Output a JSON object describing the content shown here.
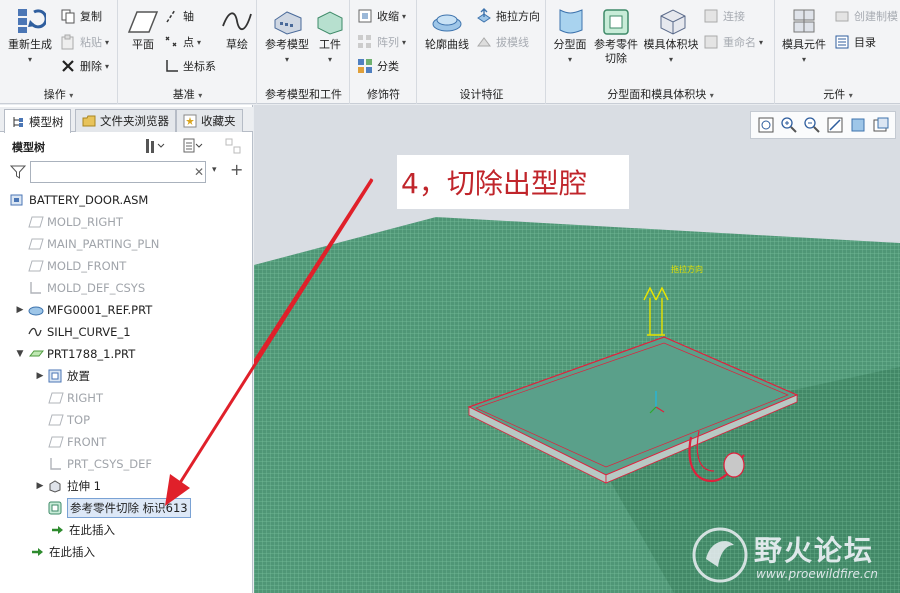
{
  "ribbon": {
    "operations": {
      "regenerate": "重新生成",
      "copy": "复制",
      "paste": "粘贴",
      "delete": "删除",
      "group": "操作"
    },
    "datum": {
      "plane": "平面",
      "axis": "轴",
      "point": "点",
      "csys": "坐标系",
      "sketch": "草绘",
      "group": "基准"
    },
    "ref_model": {
      "ref_model": "参考模型",
      "workpiece": "工件",
      "group": "参考模型和工件"
    },
    "modifiers": {
      "shrink": "收缩",
      "pattern": "阵列",
      "classify": "分类",
      "group": "修饰符"
    },
    "design": {
      "silhouette": "轮廓曲线",
      "pull_direction": "拖拉方向",
      "draft_line": "拔模线",
      "group": "设计特征"
    },
    "parting": {
      "parting_surface": "分型面",
      "ref_part_cutout_l1": "参考零件",
      "ref_part_cutout_l2": "切除",
      "mold_volume": "模具体积块",
      "connect": "连接",
      "rename": "重命名",
      "group": "分型面和模具体积块"
    },
    "components": {
      "mold_component": "模具元件",
      "create_blank": "创建制模",
      "catalog": "目录",
      "group": "元件"
    }
  },
  "leftpanel": {
    "tabs": [
      "模型树",
      "文件夹浏览器",
      "收藏夹"
    ],
    "tree_title": "模型树",
    "filter_placeholder": "",
    "filter_value": "",
    "nodes": [
      {
        "label": "BATTERY_DOOR.ASM",
        "icon": "assembly-icon"
      },
      {
        "label": "MOLD_RIGHT",
        "icon": "datum-plane-icon"
      },
      {
        "label": "MAIN_PARTING_PLN",
        "icon": "datum-plane-icon"
      },
      {
        "label": "MOLD_FRONT",
        "icon": "datum-plane-icon"
      },
      {
        "label": "MOLD_DEF_CSYS",
        "icon": "csys-icon"
      },
      {
        "label": "MFG0001_REF.PRT",
        "icon": "part-icon"
      },
      {
        "label": "SILH_CURVE_1",
        "icon": "curve-icon"
      },
      {
        "label": "PRT1788_1.PRT",
        "icon": "part-icon"
      },
      {
        "label": "放置",
        "icon": "placement-icon"
      },
      {
        "label": "RIGHT",
        "icon": "datum-plane-icon"
      },
      {
        "label": "TOP",
        "icon": "datum-plane-icon"
      },
      {
        "label": "FRONT",
        "icon": "datum-plane-icon"
      },
      {
        "label": "PRT_CSYS_DEF",
        "icon": "csys-icon"
      },
      {
        "label": "拉伸 1",
        "icon": "extrude-icon"
      },
      {
        "label": "参考零件切除 标识613",
        "icon": "cutout-icon"
      },
      {
        "label": "在此插入",
        "icon": "insert-here-icon"
      },
      {
        "label": "在此插入",
        "icon": "insert-here-icon"
      }
    ]
  },
  "viewport": {
    "callout": "4，切除出型腔",
    "pull_label": "拖拉方向",
    "watermark_cn": "野火论坛",
    "watermark_url": "www.proewildfire.cn"
  },
  "colors": {
    "mesh_green": "#5a9e80",
    "edge_red": "#e0203c",
    "annotation_red": "#c0252b",
    "arrow_yellow": "#e8e400",
    "selection_blue": "#dde8f7"
  }
}
